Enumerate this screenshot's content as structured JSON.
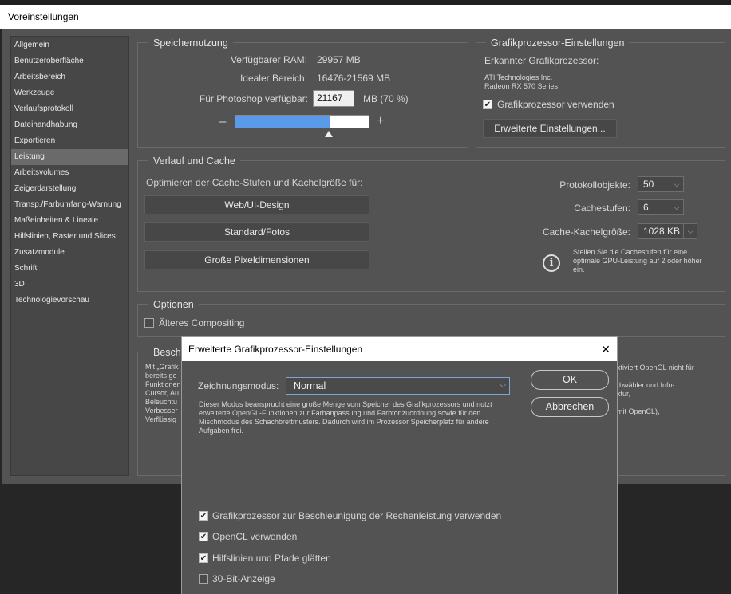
{
  "window": {
    "title": "Voreinstellungen"
  },
  "sidebar": {
    "items": [
      {
        "label": "Allgemein"
      },
      {
        "label": "Benutzeroberfläche"
      },
      {
        "label": "Arbeitsbereich"
      },
      {
        "label": "Werkzeuge"
      },
      {
        "label": "Verlaufsprotokoll"
      },
      {
        "label": "Dateihandhabung"
      },
      {
        "label": "Exportieren"
      },
      {
        "label": "Leistung"
      },
      {
        "label": "Arbeitsvolumes"
      },
      {
        "label": "Zeigerdarstellung"
      },
      {
        "label": "Transp./Farbumfang-Warnung"
      },
      {
        "label": "Maßeinheiten & Lineale"
      },
      {
        "label": "Hilfslinien, Raster und Slices"
      },
      {
        "label": "Zusatzmodule"
      },
      {
        "label": "Schrift"
      },
      {
        "label": "3D"
      },
      {
        "label": "Technologievorschau"
      }
    ],
    "active_index": 7
  },
  "memory": {
    "title": "Speichernutzung",
    "available_ram_label": "Verfügbarer RAM:",
    "available_ram_value": "29957 MB",
    "ideal_range_label": "Idealer Bereich:",
    "ideal_range_value": "16476-21569 MB",
    "photoshop_label": "Für Photoshop verfügbar:",
    "photoshop_value": "21167",
    "photoshop_unit": "MB (70 %)",
    "minus": "–",
    "plus": "+",
    "slider_fraction": 0.7
  },
  "gpu": {
    "title": "Grafikprozessor-Einstellungen",
    "detected_label": "Erkannter Grafikprozessor:",
    "vendor": "ATI Technologies Inc.",
    "model": "Radeon RX 570 Series",
    "use_gpu_label": "Grafikprozessor verwenden",
    "use_gpu_checked": true,
    "advanced_button": "Erweiterte Einstellungen..."
  },
  "history": {
    "title": "Verlauf und Cache",
    "optimize_label": "Optimieren der Cache-Stufen und Kachelgröße für:",
    "btn_web": "Web/UI-Design",
    "btn_standard": "Standard/Fotos",
    "btn_large": "Große Pixeldimensionen",
    "history_states_label": "Protokollobjekte:",
    "history_states_value": "50",
    "cache_levels_label": "Cachestufen:",
    "cache_levels_value": "6",
    "tile_size_label": "Cache-Kachelgröße:",
    "tile_size_value": "1028 KB",
    "info_text": "Stellen Sie die Cachestufen für eine optimale GPU-Leistung auf 2 oder höher ein."
  },
  "options": {
    "title": "Optionen",
    "legacy_label": "Älteres Compositing",
    "legacy_checked": false
  },
  "description": {
    "title": "Besch",
    "left_lines": [
      "Mit „Grafik",
      "bereits ge",
      "Funktionen",
      "Cursor, Au",
      "Beleuchtu",
      "Verbesser",
      "Verflüssig"
    ],
    "right_lines": [
      "ktiviert OpenGL nicht für",
      "",
      "rbwähler und Info-",
      "ktur,",
      "",
      "mit OpenCL),"
    ]
  },
  "overlay": {
    "title": "Erweiterte Grafikprozessor-Einstellungen",
    "close": "✕",
    "mode_label": "Zeichnungsmodus:",
    "mode_value": "Normal",
    "mode_desc": "Dieser Modus beansprucht eine große Menge vom Speicher des Grafikprozessors und nutzt erweiterte OpenGL-Funktionen zur Farbanpassung und Farbtonzuordnung sowie für den Mischmodus des Schachbrettmusters. Dadurch wird im Prozessor Speicherplatz für andere Aufgaben frei.",
    "ok": "OK",
    "cancel": "Abbrechen",
    "checkboxes": [
      {
        "label": "Grafikprozessor zur Beschleunigung der Rechenleistung verwenden",
        "checked": true
      },
      {
        "label": "OpenCL verwenden",
        "checked": true
      },
      {
        "label": "Hilfslinien und Pfade glätten",
        "checked": true
      },
      {
        "label": "30-Bit-Anzeige",
        "checked": false
      }
    ]
  }
}
